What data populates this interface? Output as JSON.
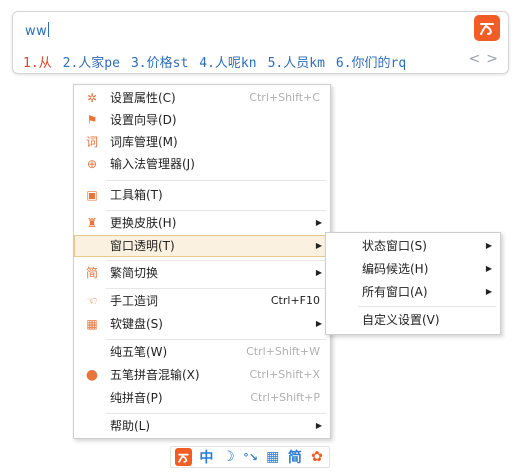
{
  "composition": {
    "text": "ww"
  },
  "logo_icon": "sogou-logo-icon",
  "candidates": [
    {
      "label": "1.从"
    },
    {
      "label": "2.人家pe"
    },
    {
      "label": "3.价格st"
    },
    {
      "label": "4.人呢kn"
    },
    {
      "label": "5.人员km"
    },
    {
      "label": "6.你们的rq"
    }
  ],
  "pager": {
    "prev": "<",
    "next": ">"
  },
  "main_menu": {
    "items": [
      {
        "label": "设置属性(C)",
        "shortcut": "Ctrl+Shift+C",
        "icon": "gear-icon"
      },
      {
        "label": "设置向导(D)",
        "shortcut": "",
        "icon": "flag-icon"
      },
      {
        "label": "词库管理(M)",
        "shortcut": "",
        "icon": "dictionary-icon"
      },
      {
        "label": "输入法管理器(J)",
        "shortcut": "",
        "icon": "manager-icon"
      },
      {
        "label": "工具箱(T)",
        "shortcut": "",
        "icon": "toolbox-icon"
      },
      {
        "label": "更换皮肤(H)",
        "shortcut": "",
        "icon": "shirt-icon"
      },
      {
        "label": "窗口透明(T)",
        "shortcut": "",
        "icon": ""
      },
      {
        "label": "繁简切换",
        "shortcut": "",
        "icon": "traditional-simplified-icon"
      },
      {
        "label": "手工造词",
        "shortcut": "Ctrl+F10",
        "icon": "hand-icon"
      },
      {
        "label": "软键盘(S)",
        "shortcut": "",
        "icon": "keyboard-icon"
      },
      {
        "label": "纯五笔(W)",
        "shortcut": "Ctrl+Shift+W",
        "icon": ""
      },
      {
        "label": "五笔拼音混输(X)",
        "shortcut": "Ctrl+Shift+X",
        "icon": "bullet-icon"
      },
      {
        "label": "纯拼音(P)",
        "shortcut": "Ctrl+Shift+P",
        "icon": ""
      },
      {
        "label": "帮助(L)",
        "shortcut": "",
        "icon": ""
      }
    ]
  },
  "sub_menu": {
    "items": [
      {
        "label": "状态窗口(S)"
      },
      {
        "label": "编码候选(H)"
      },
      {
        "label": "所有窗口(A)"
      },
      {
        "label": "自定义设置(V)"
      }
    ]
  },
  "statusbar": {
    "mode": "中",
    "punct": "☽",
    "dots": "°↘",
    "keyboard": "▦",
    "simp": "简",
    "settings": "✿"
  },
  "colors": {
    "accent": "#f25c25",
    "candidate": "#2e6db6",
    "selected": "#d9452b",
    "highlight": "#fbf1e0"
  }
}
